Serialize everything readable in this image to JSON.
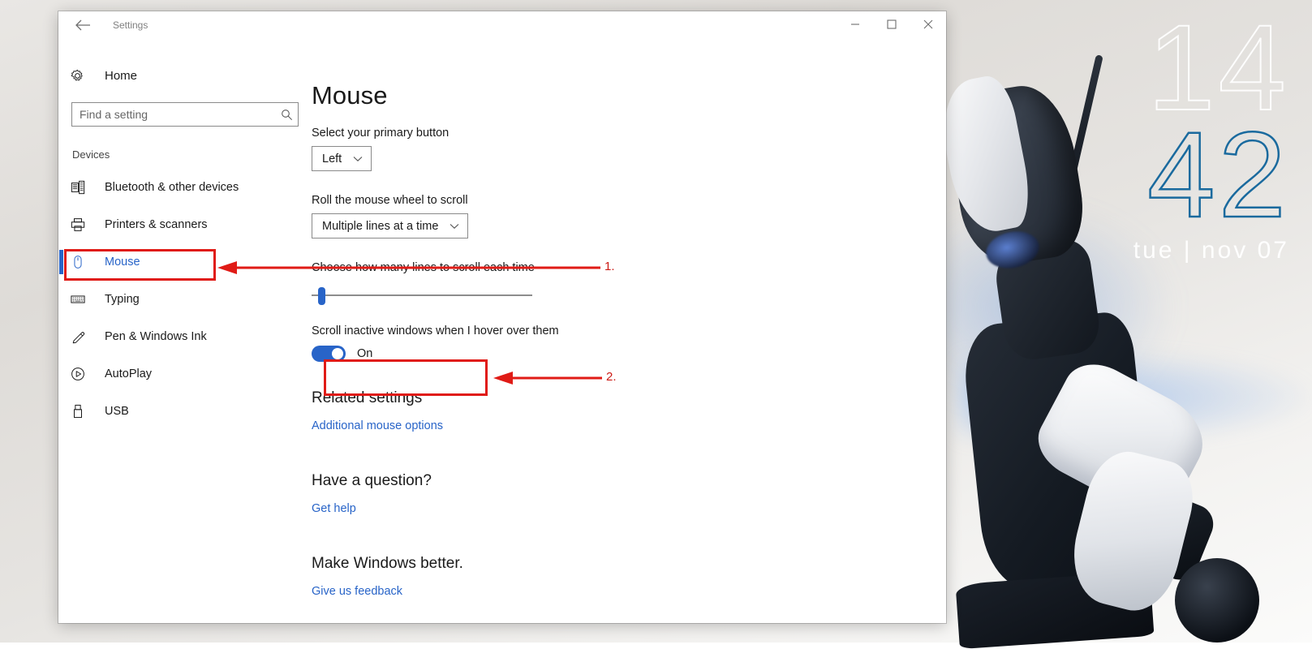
{
  "desktop": {
    "clock": {
      "hours": "14",
      "minutes": "42",
      "date": "tue | nov 07",
      "hours_color": "#ffffff",
      "minutes_color": "#1a6a9e"
    }
  },
  "window": {
    "title": "Settings",
    "back_icon": "back-arrow-icon",
    "controls": {
      "minimize": "minimize-icon",
      "maximize": "maximize-icon",
      "close": "close-icon"
    }
  },
  "sidebar": {
    "home": {
      "label": "Home",
      "icon": "gear-icon"
    },
    "search": {
      "placeholder": "Find a setting",
      "value": "",
      "icon": "search-icon"
    },
    "group_heading": "Devices",
    "items": [
      {
        "label": "Bluetooth & other devices",
        "icon": "bluetooth-device-icon",
        "selected": false
      },
      {
        "label": "Printers & scanners",
        "icon": "printer-icon",
        "selected": false
      },
      {
        "label": "Mouse",
        "icon": "mouse-icon",
        "selected": true
      },
      {
        "label": "Typing",
        "icon": "keyboard-icon",
        "selected": false
      },
      {
        "label": "Pen & Windows Ink",
        "icon": "pen-icon",
        "selected": false
      },
      {
        "label": "AutoPlay",
        "icon": "play-circle-icon",
        "selected": false
      },
      {
        "label": "USB",
        "icon": "usb-icon",
        "selected": false
      }
    ],
    "accent_color": "#2864c8"
  },
  "main": {
    "title": "Mouse",
    "primary_button": {
      "label": "Select your primary button",
      "value": "Left"
    },
    "wheel_scroll": {
      "label": "Roll the mouse wheel to scroll",
      "value": "Multiple lines at a time"
    },
    "lines_slider": {
      "label": "Choose how many lines to scroll each time",
      "percent": 3
    },
    "inactive_scroll": {
      "label": "Scroll inactive windows when I hover over them",
      "state": "On",
      "enabled": true
    },
    "related_settings": {
      "heading": "Related settings",
      "link": "Additional mouse options"
    },
    "question": {
      "heading": "Have a question?",
      "link": "Get help"
    },
    "feedback": {
      "heading": "Make Windows better.",
      "link": "Give us feedback"
    }
  },
  "annotations": {
    "color": "#e01b16",
    "marker_1": "1.",
    "marker_2": "2."
  }
}
